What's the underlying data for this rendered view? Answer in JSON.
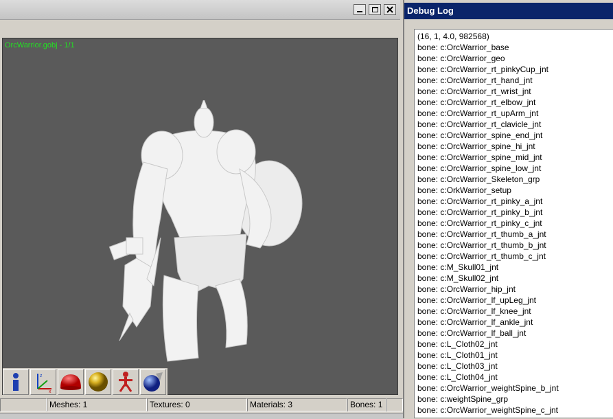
{
  "viewer": {
    "viewport_label": "OrcWarrior.gobj - 1/1",
    "status": {
      "meshes": "Meshes: 1",
      "textures": "Textures: 0",
      "materials": "Materials: 3",
      "bones": "Bones: 1"
    },
    "toolbar": [
      "info-icon",
      "axes-icon",
      "dome-icon",
      "sphere-icon",
      "skeleton-icon",
      "material-paint-icon"
    ]
  },
  "debug_log": {
    "title": "Debug Log",
    "lines": [
      "(16, 1, 4.0, 982568)",
      "bone:  c:OrcWarrior_base",
      "bone:  c:OrcWarrior_geo",
      "bone:  c:OrcWarrior_rt_pinkyCup_jnt",
      "bone:  c:OrcWarrior_rt_hand_jnt",
      "bone:  c:OrcWarrior_rt_wrist_jnt",
      "bone:  c:OrcWarrior_rt_elbow_jnt",
      "bone:  c:OrcWarrior_rt_upArm_jnt",
      "bone:  c:OrcWarrior_rt_clavicle_jnt",
      "bone:  c:OrcWarrior_spine_end_jnt",
      "bone:  c:OrcWarrior_spine_hi_jnt",
      "bone:  c:OrcWarrior_spine_mid_jnt",
      "bone:  c:OrcWarrior_spine_low_jnt",
      "bone:  c:OrcWarrior_Skeleton_grp",
      "bone:  c:OrkWarrior_setup",
      "bone:  c:OrcWarrior_rt_pinky_a_jnt",
      "bone:  c:OrcWarrior_rt_pinky_b_jnt",
      "bone:  c:OrcWarrior_rt_pinky_c_jnt",
      "bone:  c:OrcWarrior_rt_thumb_a_jnt",
      "bone:  c:OrcWarrior_rt_thumb_b_jnt",
      "bone:  c:OrcWarrior_rt_thumb_c_jnt",
      "bone:  c:M_Skull01_jnt",
      "bone:  c:M_Skull02_jnt",
      "bone:  c:OrcWarrior_hip_jnt",
      "bone:  c:OrcWarrior_lf_upLeg_jnt",
      "bone:  c:OrcWarrior_lf_knee_jnt",
      "bone:  c:OrcWarrior_lf_ankle_jnt",
      "bone:  c:OrcWarrior_lf_ball_jnt",
      "bone:  c:L_Cloth02_jnt",
      "bone:  c:L_Cloth01_jnt",
      "bone:  c:L_Cloth03_jnt",
      "bone:  c:L_Cloth04_jnt",
      "bone:  c:OrcWarrior_weightSpine_b_jnt",
      "bone:  c:weightSpine_grp",
      "bone:  c:OrcWarrior_weightSpine_c_jnt"
    ]
  },
  "colors": {
    "viewport_bg": "#5a5a5a",
    "label_green": "#22e022",
    "debug_title_bg": "#0a246a",
    "model": "#f2f2f2"
  }
}
